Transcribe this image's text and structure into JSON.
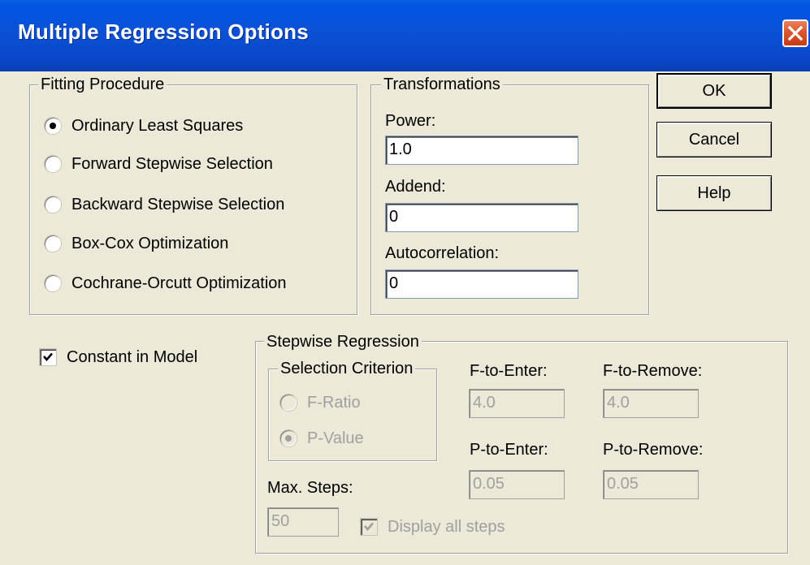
{
  "window": {
    "title": "Multiple Regression Options"
  },
  "fitting": {
    "legend": "Fitting Procedure",
    "options": [
      {
        "label": "Ordinary Least Squares",
        "selected": true
      },
      {
        "label": "Forward Stepwise Selection",
        "selected": false
      },
      {
        "label": "Backward Stepwise Selection",
        "selected": false
      },
      {
        "label": "Box-Cox Optimization",
        "selected": false
      },
      {
        "label": "Cochrane-Orcutt Optimization",
        "selected": false
      }
    ]
  },
  "transformations": {
    "legend": "Transformations",
    "power_label": "Power:",
    "power_value": "1.0",
    "addend_label": "Addend:",
    "addend_value": "0",
    "autocorr_label": "Autocorrelation:",
    "autocorr_value": "0"
  },
  "buttons": {
    "ok": "OK",
    "cancel": "Cancel",
    "help": "Help"
  },
  "constant": {
    "label": "Constant in Model",
    "checked": true
  },
  "stepwise": {
    "legend": "Stepwise Regression",
    "criterion_legend": "Selection Criterion",
    "criterion_options": [
      {
        "label": "F-Ratio",
        "selected": false
      },
      {
        "label": "P-Value",
        "selected": true
      }
    ],
    "f_to_enter_label": "F-to-Enter:",
    "f_to_enter_value": "4.0",
    "f_to_remove_label": "F-to-Remove:",
    "f_to_remove_value": "4.0",
    "p_to_enter_label": "P-to-Enter:",
    "p_to_enter_value": "0.05",
    "p_to_remove_label": "P-to-Remove:",
    "p_to_remove_value": "0.05",
    "max_steps_label": "Max. Steps:",
    "max_steps_value": "50",
    "display_all_label": "Display all steps",
    "display_all_checked": true
  },
  "colors": {
    "titlebar": "#0a4fd6",
    "dialog_bg": "#ece9d8",
    "disabled_text": "#a0a0a0",
    "close_button": "#d9532b"
  }
}
